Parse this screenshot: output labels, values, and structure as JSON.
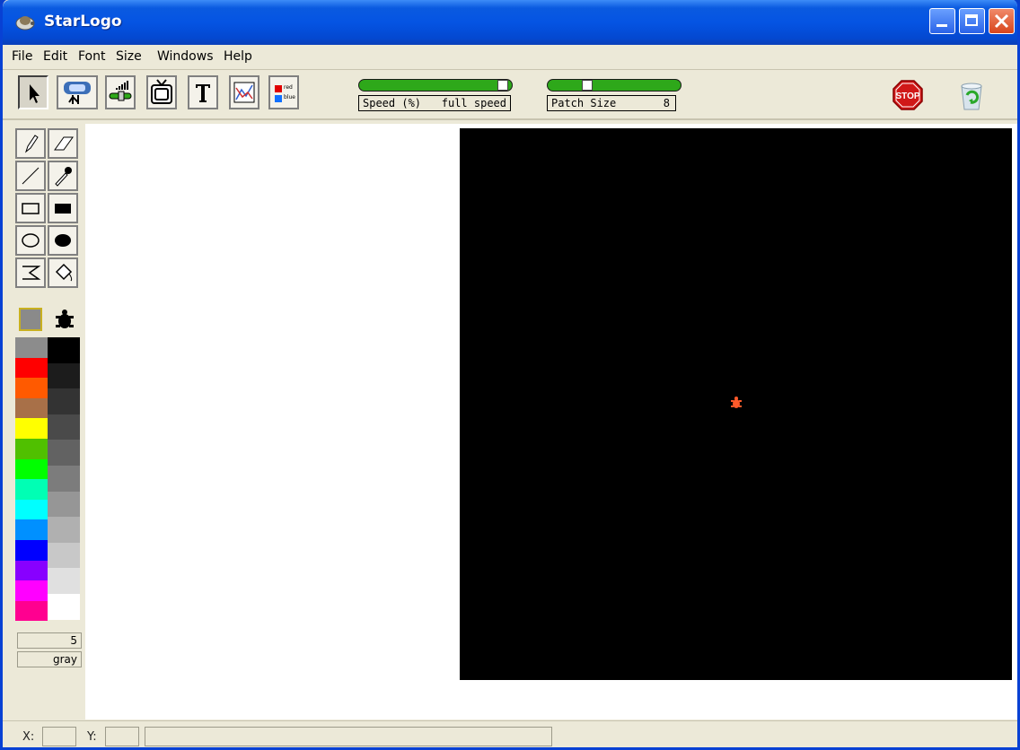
{
  "window": {
    "title": "StarLogo"
  },
  "menu": {
    "file": "File",
    "edit": "Edit",
    "font": "Font",
    "size": "Size",
    "windows": "Windows",
    "help": "Help"
  },
  "toolbar": {
    "tools": [
      "arrow-select",
      "turtle-monitor",
      "slider-tool",
      "monitor-tv-tool",
      "text-tool",
      "graph-tool",
      "color-pair-tool"
    ],
    "color_pair": {
      "red": "red",
      "blue": "blue"
    },
    "speed_slider": {
      "label": "Speed (%)",
      "value": "full speed",
      "fraction": 0.98
    },
    "patch_slider": {
      "label": "Patch Size",
      "value": "8",
      "fraction": 0.26
    },
    "stop_label": "STOP",
    "trash_icon": "recycle-bin-icon"
  },
  "drawing_tools": [
    "pencil",
    "eraser",
    "line",
    "eyedropper",
    "rect-outline",
    "rect-filled",
    "ellipse-outline",
    "ellipse-filled",
    "sigma-shape",
    "paint-bucket"
  ],
  "palette": {
    "current_fill": "#8a8a8a",
    "left_colors": [
      "#8c8c8c",
      "#ff0000",
      "#ff5a00",
      "#a87048",
      "#ffff00",
      "#50c000",
      "#00ff00",
      "#00ffb4",
      "#00ffff",
      "#0090ff",
      "#0000ff",
      "#8800ff",
      "#ff00ff",
      "#ff0090"
    ],
    "right_colors": [
      "#000000",
      "#1c1c1c",
      "#333333",
      "#4a4a4a",
      "#626262",
      "#7c7c7c",
      "#969696",
      "#b0b0b0",
      "#c8c8c8",
      "#e0e0e0",
      "#ffffff"
    ]
  },
  "color_info": {
    "number": "5",
    "name": "gray"
  },
  "status": {
    "x_label": "X:",
    "y_label": "Y:"
  },
  "colors": {
    "turtle": "#ff5a2a",
    "grid": "#000000"
  }
}
